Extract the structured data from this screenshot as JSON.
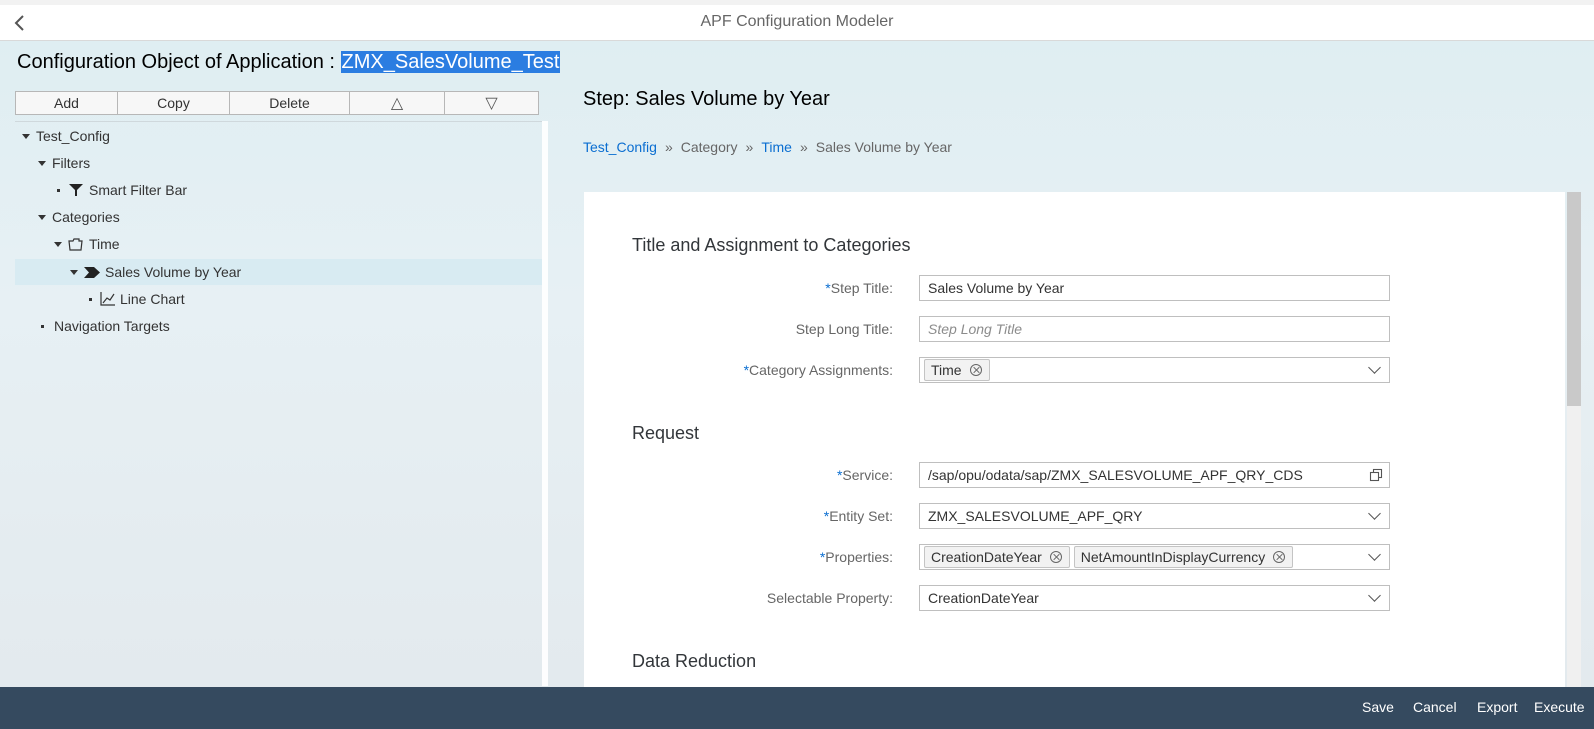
{
  "shell": {
    "app_title": "APF Configuration Modeler",
    "back_icon": "chevron-left-icon"
  },
  "header": {
    "prefix": "Configuration Object of Application : ",
    "application_id": "ZMX_SalesVolume_Test"
  },
  "toolbar": {
    "add": "Add",
    "copy": "Copy",
    "delete": "Delete",
    "move_up": "△",
    "move_down": "▽"
  },
  "tree": {
    "items": [
      {
        "label": "Test_Config"
      },
      {
        "label": "Filters"
      },
      {
        "label": "Smart Filter Bar",
        "icon": "filter-icon"
      },
      {
        "label": "Categories"
      },
      {
        "label": "Time",
        "icon": "category-folder-icon"
      },
      {
        "label": "Sales Volume by Year",
        "icon": "step-arrow-icon",
        "selected": true
      },
      {
        "label": "Line Chart",
        "icon": "line-chart-icon"
      },
      {
        "label": "Navigation Targets"
      }
    ]
  },
  "detail": {
    "title": "Step: Sales Volume by Year",
    "breadcrumb": [
      "Test_Config",
      "Category",
      "Time",
      "Sales Volume by Year"
    ],
    "sections": {
      "title_assignment": "Title and Assignment to Categories",
      "request": "Request",
      "data_reduction": "Data Reduction"
    },
    "fields": {
      "step_title": {
        "label": "Step Title:",
        "value": "Sales Volume by Year"
      },
      "step_long_title": {
        "label": "Step Long Title:",
        "placeholder": "Step Long Title"
      },
      "category_assignments": {
        "label": "Category Assignments:",
        "tokens": [
          "Time"
        ]
      },
      "service": {
        "label": "Service:",
        "value": "/sap/opu/odata/sap/ZMX_SALESVOLUME_APF_QRY_CDS"
      },
      "entity_set": {
        "label": "Entity Set:",
        "value": "ZMX_SALESVOLUME_APF_QRY"
      },
      "properties": {
        "label": "Properties:",
        "tokens": [
          "CreationDateYear",
          "NetAmountInDisplayCurrency"
        ]
      },
      "selectable_property": {
        "label": "Selectable Property:",
        "value": "CreationDateYear"
      }
    },
    "required_marker": "*"
  },
  "footer": {
    "save": "Save",
    "cancel": "Cancel",
    "export": "Export",
    "execute": "Execute"
  },
  "colors": {
    "footer_bg": "#354a5f",
    "link": "#0a6ed1",
    "selection": "#2b7de1"
  }
}
